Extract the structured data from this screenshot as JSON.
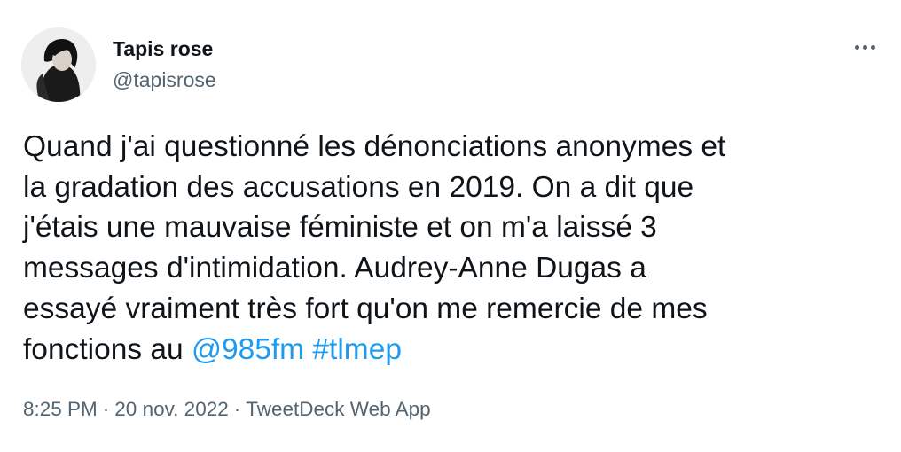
{
  "author": {
    "name": "Tapis rose",
    "handle": "@tapisrose",
    "avatar_icon": "profile-photo"
  },
  "more_icon": "more-horizontal-icon",
  "tweet": {
    "text_lines": [
      "Quand j'ai questionné les dénonciations anonymes et",
      "la gradation des accusations en 2019. On a dit que",
      "j'étais une mauvaise féministe et on m'a laissé 3",
      "messages d'intimidation. Audrey-Anne Dugas a",
      "essayé vraiment très fort qu'on me remercie de mes"
    ],
    "last_line_prefix": "fonctions au ",
    "mention": "@985fm",
    "hashtag": "#tlmep"
  },
  "meta": {
    "time": "8:25 PM",
    "separator": "·",
    "date": "20 nov. 2022",
    "source": "TweetDeck Web App"
  },
  "colors": {
    "text": "#0f1419",
    "secondary": "#536471",
    "link": "#1d9bf0",
    "background": "#ffffff"
  }
}
